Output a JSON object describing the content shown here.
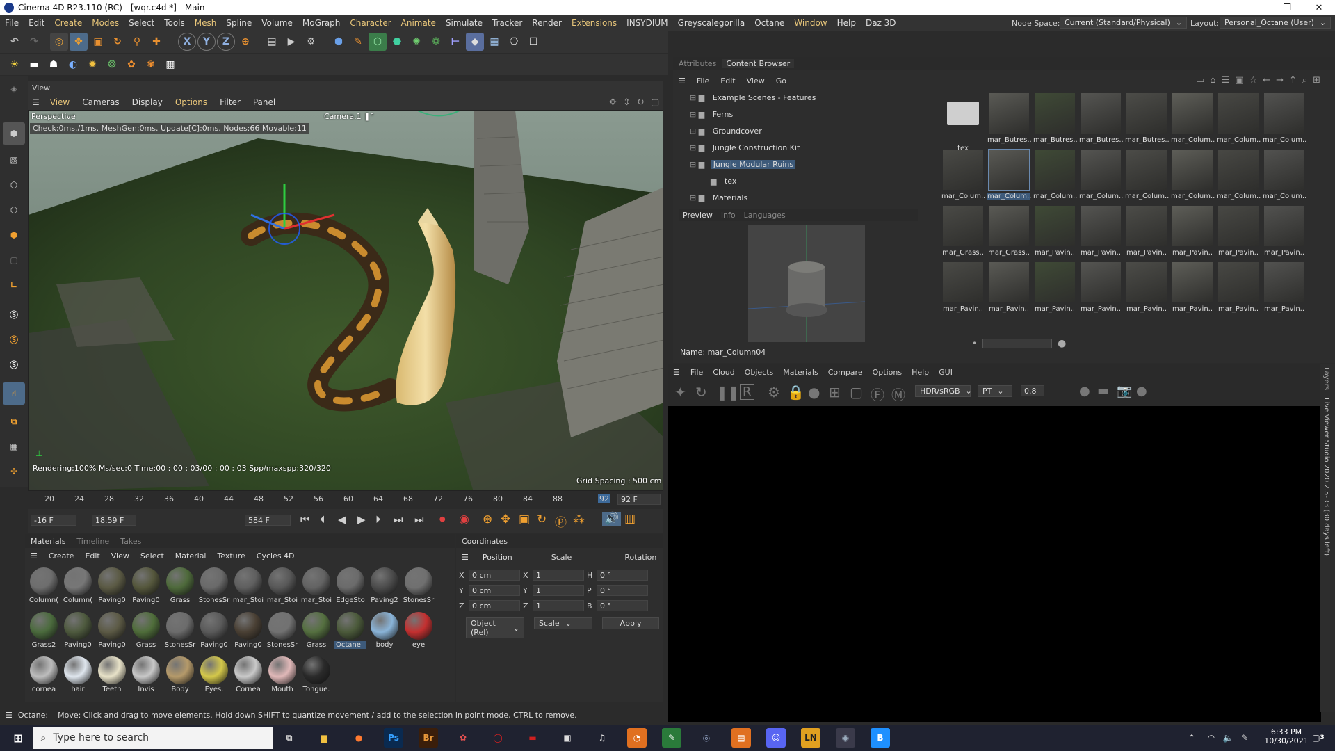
{
  "window": {
    "title": "Cinema 4D R23.110 (RC) - [wqr.c4d *] - Main",
    "min": "—",
    "max": "❐",
    "close": "✕"
  },
  "menubar": {
    "items": [
      "File",
      "Edit",
      "Create",
      "Modes",
      "Select",
      "Tools",
      "Mesh",
      "Spline",
      "Volume",
      "MoGraph",
      "Character",
      "Animate",
      "Simulate",
      "Tracker",
      "Render",
      "Extensions",
      "INSYDIUM",
      "Greyscalegorilla",
      "Octane",
      "Window",
      "Help",
      "Daz 3D"
    ],
    "node_space_label": "Node Space:",
    "node_space_value": "Current (Standard/Physical)",
    "layout_label": "Layout:",
    "layout_value": "Personal_Octane (User)"
  },
  "viewport": {
    "panel_title": "View",
    "menus": [
      "View",
      "Cameras",
      "Display",
      "Options",
      "Filter",
      "Panel"
    ],
    "label": "Perspective",
    "camera": "Camera.1 ❚°",
    "info": "Check:0ms./1ms. MeshGen:0ms. Update[C]:0ms. Nodes:66 Movable:11",
    "render_status": "Rendering:100% Ms/sec:0 Time:00 : 00 : 03/00 : 00 : 03 Spp/maxspp:320/320",
    "grid_spacing": "Grid Spacing : 500 cm"
  },
  "timeline": {
    "ticks": [
      "20",
      "24",
      "28",
      "32",
      "36",
      "40",
      "44",
      "48",
      "52",
      "56",
      "60",
      "64",
      "68",
      "72",
      "76",
      "80",
      "84",
      "88",
      "92"
    ],
    "current_frame": "92 F",
    "start": "-16 F",
    "fps": "18.59 F",
    "end": "584 F"
  },
  "materials": {
    "tabs": [
      "Materials",
      "Timeline",
      "Takes"
    ],
    "menus": [
      "Create",
      "Edit",
      "View",
      "Select",
      "Material",
      "Texture",
      "Cycles 4D"
    ],
    "items": [
      {
        "label": "Column(",
        "color": "#6e6e6e"
      },
      {
        "label": "Column(",
        "color": "#777"
      },
      {
        "label": "Paving0",
        "color": "#5b5a44"
      },
      {
        "label": "Paving0",
        "color": "#55573c"
      },
      {
        "label": "Grass",
        "color": "#4e6a3b"
      },
      {
        "label": "StonesSr",
        "color": "#6a6a6a"
      },
      {
        "label": "mar_Stoi",
        "color": "#5f5f5f"
      },
      {
        "label": "mar_Stoi",
        "color": "#585858"
      },
      {
        "label": "mar_Stoi",
        "color": "#636363"
      },
      {
        "label": "EdgeSto",
        "color": "#6b6b6b"
      },
      {
        "label": "Paving2",
        "color": "#4c4c4c"
      },
      {
        "label": "StonesSr",
        "color": "#707070"
      },
      {
        "label": "Grass2",
        "color": "#4b6b3d"
      },
      {
        "label": "Paving0",
        "color": "#4e5a3e"
      },
      {
        "label": "Paving0",
        "color": "#5c5a45"
      },
      {
        "label": "Grass",
        "color": "#4f6d3a"
      },
      {
        "label": "StonesSr",
        "color": "#6c6c6c"
      },
      {
        "label": "Paving0",
        "color": "#5a5a5a"
      },
      {
        "label": "Paving0",
        "color": "#4a4034"
      },
      {
        "label": "StonesSr",
        "color": "#727272"
      },
      {
        "label": "Grass",
        "color": "#557040"
      },
      {
        "label": "Octane I",
        "color": "#4b5a3a"
      },
      {
        "label": "body",
        "color": "#8ab4d8"
      },
      {
        "label": "eye",
        "color": "#c43030"
      },
      {
        "label": "cornea",
        "color": "#bdbdbd"
      },
      {
        "label": "hair",
        "color": "#dfe6ee"
      },
      {
        "label": "Teeth",
        "color": "#e8e2c8"
      },
      {
        "label": "Invis",
        "color": "#c8c8c8"
      },
      {
        "label": "Body",
        "color": "#b59a6a"
      },
      {
        "label": "Eyes.",
        "color": "#d4c84a"
      },
      {
        "label": "Cornea",
        "color": "#c9c9c9"
      },
      {
        "label": "Mouth",
        "color": "#e0b8b8"
      },
      {
        "label": "Tongue.",
        "color": "#2a2a2a"
      }
    ]
  },
  "coordinates": {
    "title": "Coordinates",
    "headers": [
      "Position",
      "Scale",
      "Rotation"
    ],
    "rows": [
      {
        "axis": "X",
        "pos": "0 cm",
        "saxis": "X",
        "scale": "1",
        "raxis": "H",
        "rot": "0 °"
      },
      {
        "axis": "Y",
        "pos": "0 cm",
        "saxis": "Y",
        "scale": "1",
        "raxis": "P",
        "rot": "0 °"
      },
      {
        "axis": "Z",
        "pos": "0 cm",
        "saxis": "Z",
        "scale": "1",
        "raxis": "B",
        "rot": "0 °"
      }
    ],
    "mode": "Object (Rel)",
    "scale_mode": "Scale",
    "apply": "Apply"
  },
  "content_browser": {
    "tabs": [
      "Attributes",
      "Content Browser"
    ],
    "menus": [
      "File",
      "Edit",
      "View",
      "Go"
    ],
    "tree": [
      "Example Scenes - Features",
      "Ferns",
      "Groundcover",
      "Jungle Construction Kit",
      "Jungle Modular Ruins",
      "tex",
      "Materials"
    ],
    "preview_tabs": [
      "Preview",
      "Info",
      "Languages"
    ],
    "name_label": "Name: mar_Column04",
    "thumbs": [
      "tex",
      "mar_Butres..",
      "mar_Butres..",
      "mar_Butres..",
      "mar_Butres..",
      "mar_Colum..",
      "mar_Colum..",
      "mar_Colum..",
      "mar_Colum..",
      "mar_Colum..",
      "mar_Colum..",
      "mar_Colum..",
      "mar_Colum..",
      "mar_Colum..",
      "mar_Colum..",
      "mar_Colum..",
      "mar_Grass..",
      "mar_Grass..",
      "mar_Pavin..",
      "mar_Pavin..",
      "mar_Pavin..",
      "mar_Pavin..",
      "mar_Pavin..",
      "mar_Pavin..",
      "mar_Pavin..",
      "mar_Pavin..",
      "mar_Pavin..",
      "mar_Pavin..",
      "mar_Pavin..",
      "mar_Pavin..",
      "mar_Pavin..",
      "mar_Pavin.."
    ]
  },
  "octane": {
    "menus": [
      "File",
      "Cloud",
      "Objects",
      "Materials",
      "Compare",
      "Options",
      "Help",
      "GUI"
    ],
    "color_space": "HDR/sRGB",
    "kernel": "PT",
    "exposure": "0.8",
    "side_label": "Live Viewer Studio 2020.2.5-R3 (30 days left)",
    "layers_label": "Layers"
  },
  "status": {
    "prefix": "Octane:",
    "text": "Move: Click and drag to move elements. Hold down SHIFT to quantize movement / add to the selection in point mode, CTRL to remove."
  },
  "taskbar": {
    "search_placeholder": "Type here to search",
    "time": "6:33 PM",
    "date": "10/30/2021",
    "notifications": "3"
  }
}
